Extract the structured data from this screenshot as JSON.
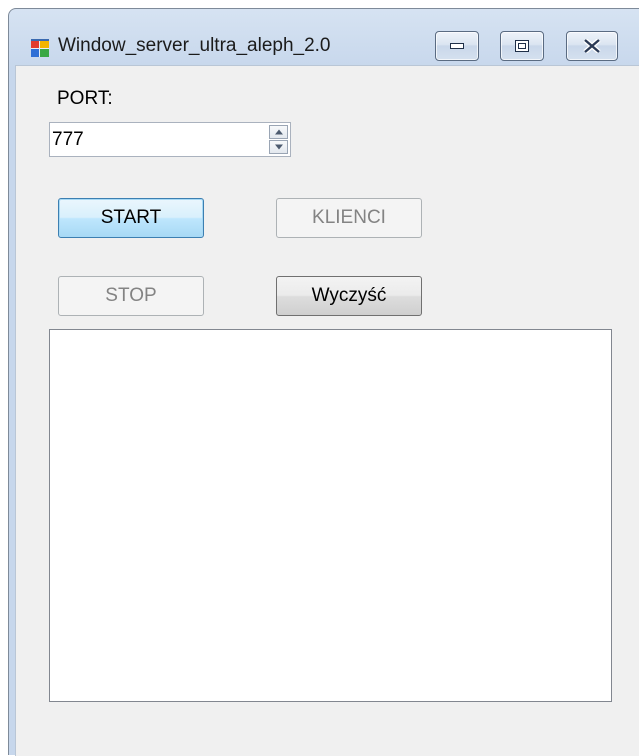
{
  "window": {
    "title": "Window_server_ultra_aleph_2.0",
    "icon": "app-form-icon",
    "caption_buttons": [
      "minimize-icon",
      "restore-icon",
      "close-icon"
    ]
  },
  "form": {
    "port_label": "PORT:",
    "port_value": "777",
    "buttons": {
      "start": "START",
      "klienci": "KLIENCI",
      "stop": "STOP",
      "wyczysc": "Wyczyść"
    },
    "log_text": ""
  },
  "colors": {
    "title_gradient": "#c7d7ec",
    "client_bg": "#f0f0f0",
    "focused_border": "#3c7fb1",
    "disabled_text": "#838383"
  }
}
